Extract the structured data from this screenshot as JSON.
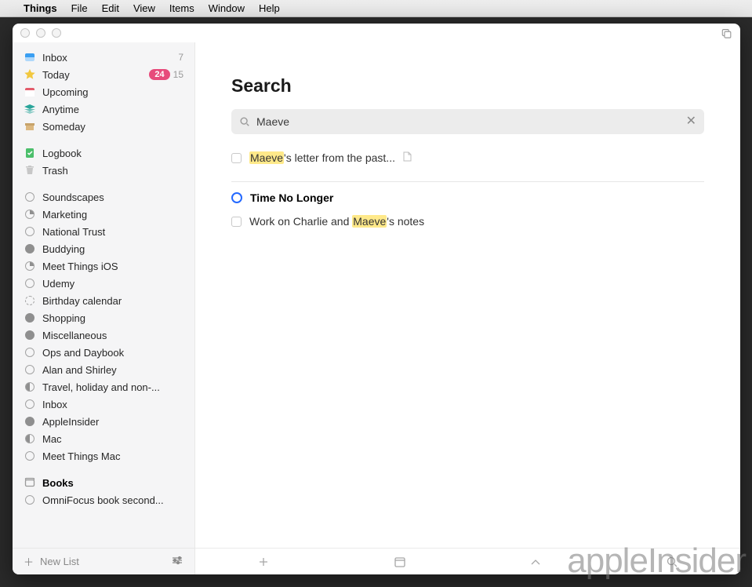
{
  "menubar": {
    "items": [
      "Things",
      "File",
      "Edit",
      "View",
      "Items",
      "Window",
      "Help"
    ]
  },
  "sidebar": {
    "smart": [
      {
        "label": "Inbox",
        "count": "7"
      },
      {
        "label": "Today",
        "badge": "24",
        "count": "15"
      },
      {
        "label": "Upcoming"
      },
      {
        "label": "Anytime"
      },
      {
        "label": "Someday"
      }
    ],
    "system": [
      {
        "label": "Logbook"
      },
      {
        "label": "Trash"
      }
    ],
    "projects": [
      {
        "label": "Soundscapes",
        "ring": "empty"
      },
      {
        "label": "Marketing",
        "ring": "q1"
      },
      {
        "label": "National Trust",
        "ring": "empty"
      },
      {
        "label": "Buddying",
        "ring": "filled"
      },
      {
        "label": "Meet Things iOS",
        "ring": "q1"
      },
      {
        "label": "Udemy",
        "ring": "empty"
      },
      {
        "label": "Birthday calendar",
        "ring": "dashed"
      },
      {
        "label": "Shopping",
        "ring": "filled"
      },
      {
        "label": "Miscellaneous",
        "ring": "filled"
      },
      {
        "label": "Ops and Daybook",
        "ring": "empty"
      },
      {
        "label": "Alan and Shirley",
        "ring": "empty"
      },
      {
        "label": "Travel, holiday and non-...",
        "ring": "half"
      },
      {
        "label": "Inbox",
        "ring": "empty"
      },
      {
        "label": "AppleInsider",
        "ring": "filled"
      },
      {
        "label": "Mac",
        "ring": "half"
      },
      {
        "label": "Meet Things Mac",
        "ring": "empty"
      }
    ],
    "areas": [
      {
        "label": "Books"
      }
    ],
    "area_children": [
      {
        "label": "OmniFocus book second...",
        "ring": "empty"
      }
    ],
    "footer": {
      "new_list": "New List"
    }
  },
  "main": {
    "title": "Search",
    "search": {
      "value": "Maeve",
      "placeholder": ""
    },
    "results_loose": [
      {
        "pre": "",
        "match": "Maeve",
        "post": "'s letter from the past...",
        "note": true
      }
    ],
    "section": {
      "title": "Time No Longer"
    },
    "results_section": [
      {
        "pre": "Work on Charlie and ",
        "match": "Maeve",
        "post": "'s notes"
      }
    ]
  },
  "watermark": "appleInsider"
}
